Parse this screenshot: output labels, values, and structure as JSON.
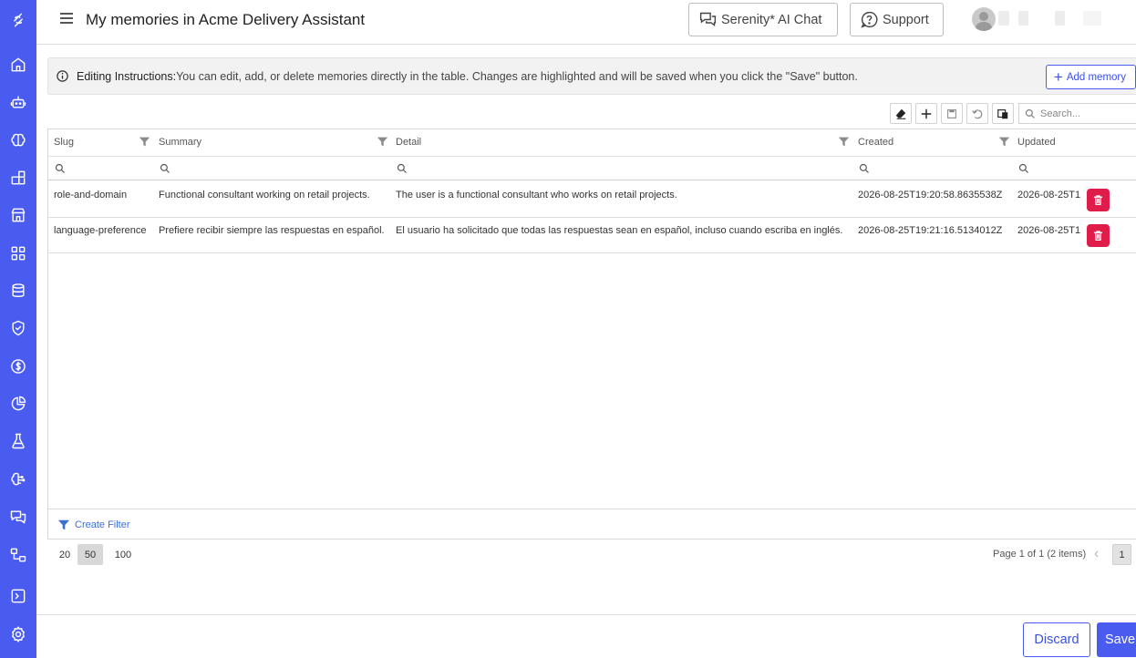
{
  "header": {
    "title": "My memories in Acme Delivery Assistant",
    "chat_button": "Serenity* AI Chat",
    "support_button": "Support"
  },
  "banner": {
    "label": "Editing Instructions:",
    "text": "You can edit, add, or delete memories directly in the table. Changes are highlighted and will be saved when you click the \"Save\" button.",
    "add_button": "Add memory"
  },
  "toolbar": {
    "search_placeholder": "Search..."
  },
  "grid": {
    "columns": [
      "Slug",
      "Summary",
      "Detail",
      "Created",
      "Updated"
    ],
    "rows": [
      {
        "slug": "role-and-domain",
        "summary": "Functional consultant working on retail projects.",
        "detail": "The user is a functional consultant who works on retail projects.",
        "created": "2026-08-25T19:20:58.8635538Z",
        "updated": "2026-08-25T1"
      },
      {
        "slug": "language-preference",
        "summary": "Prefiere recibir siempre las respuestas en español.",
        "detail": "El usuario ha solicitado que todas las respuestas sean en español, incluso cuando escriba en inglés.",
        "created": "2026-08-25T19:21:16.5134012Z",
        "updated": "2026-08-25T1"
      }
    ],
    "create_filter": "Create Filter"
  },
  "pager": {
    "sizes": [
      "20",
      "50",
      "100"
    ],
    "active_size": "50",
    "info": "Page 1 of 1 (2 items)",
    "current_page": "1"
  },
  "actions": {
    "discard": "Discard",
    "save": "Save"
  },
  "colors": {
    "sidebar": "#4a5cf0",
    "primary": "#4a5cf0",
    "delete": "#e01c4b"
  },
  "sidebar_icons": [
    "logo-icon",
    "home-icon",
    "robot-icon",
    "brain-icon",
    "blocks-icon",
    "store-icon",
    "grid-icon",
    "database-icon",
    "shield-icon",
    "dollar-icon",
    "pie-chart-icon",
    "flask-icon",
    "brain-circuit-icon",
    "messages-icon",
    "workflow-icon",
    "terminal-icon",
    "settings-icon"
  ]
}
